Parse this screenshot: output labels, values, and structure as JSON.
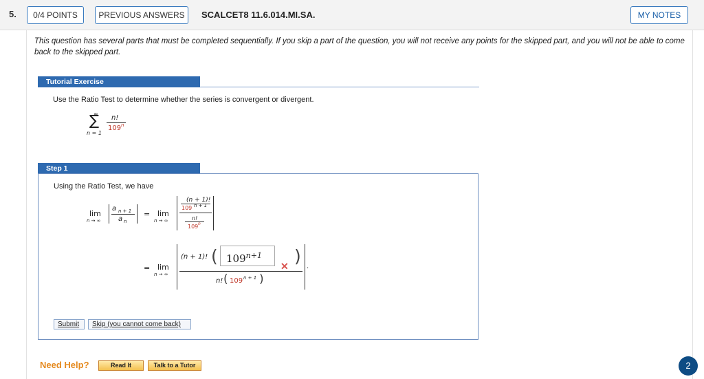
{
  "header": {
    "question_number": "5.",
    "points_button": "0/4 POINTS",
    "previous_answers_button": "PREVIOUS ANSWERS",
    "question_id": "SCALCET8 11.6.014.MI.SA.",
    "my_notes_button": "MY NOTES"
  },
  "notice": "This question has several parts that must be completed sequentially. If you skip a part of the question, you will not receive any points for the skipped part, and you will not be able to come back to the skipped part.",
  "tutorial": {
    "header": "Tutorial Exercise",
    "instruction": "Use the Ratio Test to determine whether the series is convergent or divergent.",
    "series": {
      "sigma": "∑",
      "upper": "∞",
      "lower": "n = 1",
      "numerator": "n!",
      "denominator_base": "109",
      "denominator_exp": "n"
    }
  },
  "step1": {
    "header": "Step 1",
    "text": "Using the Ratio Test, we have",
    "lim": "lim",
    "lim_sub": "n → ∞",
    "a_next": "a",
    "a_next_sub": "n + 1",
    "a_n": "a",
    "a_n_sub": "n",
    "equals": "=",
    "frac_top_num": "(n + 1)!",
    "frac_top_den_base": "109",
    "frac_top_den_exp": "n + 1",
    "frac_bot_num": "n!",
    "frac_bot_den_base": "109",
    "frac_bot_den_exp": "n",
    "line2_num_prefix": "(n + 1)!",
    "answer_base": "109",
    "answer_exp": "n+1",
    "answer_status": "incorrect",
    "incorrect_mark": "✕",
    "line2_den_prefix": "n!",
    "line2_den_base": "109",
    "line2_den_exp": "n + 1",
    "period": "."
  },
  "buttons": {
    "submit": "Submit",
    "skip": "Skip (you cannot come back)"
  },
  "help": {
    "label": "Need Help?",
    "read_it": "Read It",
    "talk_to_tutor": "Talk to a Tutor"
  },
  "badge_count": "2",
  "colors": {
    "accent_blue": "#2e6ab0",
    "error_red": "#c0392b",
    "help_orange": "#e58a1f",
    "badge_navy": "#0e4c84"
  }
}
